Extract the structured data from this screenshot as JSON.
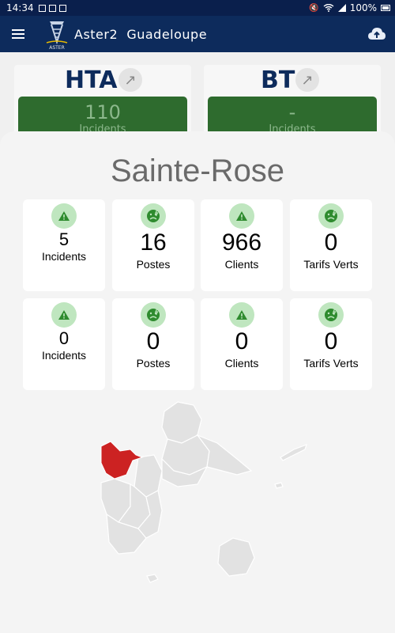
{
  "status_bar": {
    "time": "14:34",
    "battery": "100%"
  },
  "app_bar": {
    "title": "Aster2  Guadeloupe",
    "logo_text": "ASTER"
  },
  "summary_cards": [
    {
      "label": "HTA",
      "value": "110",
      "sublabel": "Incidents"
    },
    {
      "label": "BT",
      "value": "-",
      "sublabel": "Incidents"
    }
  ],
  "sheet": {
    "title": "Sainte-Rose",
    "rows": [
      [
        {
          "value": "5",
          "label": "Incidents",
          "icon": "warning-icon"
        },
        {
          "value": "16",
          "label": "Postes",
          "icon": "frown-bolt-icon"
        },
        {
          "value": "966",
          "label": "Clients",
          "icon": "warning-icon"
        },
        {
          "value": "0",
          "label": "Tarifs Verts",
          "icon": "frown-bolt-icon"
        }
      ],
      [
        {
          "value": "0",
          "label": "Incidents",
          "icon": "warning-icon"
        },
        {
          "value": "0",
          "label": "Postes",
          "icon": "frown-bolt-icon"
        },
        {
          "value": "0",
          "label": "Clients",
          "icon": "warning-icon"
        },
        {
          "value": "0",
          "label": "Tarifs Verts",
          "icon": "frown-bolt-icon"
        }
      ]
    ]
  },
  "colors": {
    "app_bar": "#0d2b5c",
    "status_bar": "#0a1f4c",
    "card_green": "#2e6b2e",
    "icon_bg": "#bfe6bf",
    "icon_fg": "#2e8b2e",
    "highlight_region": "#cc2222",
    "map_region": "#e2e2e2"
  }
}
